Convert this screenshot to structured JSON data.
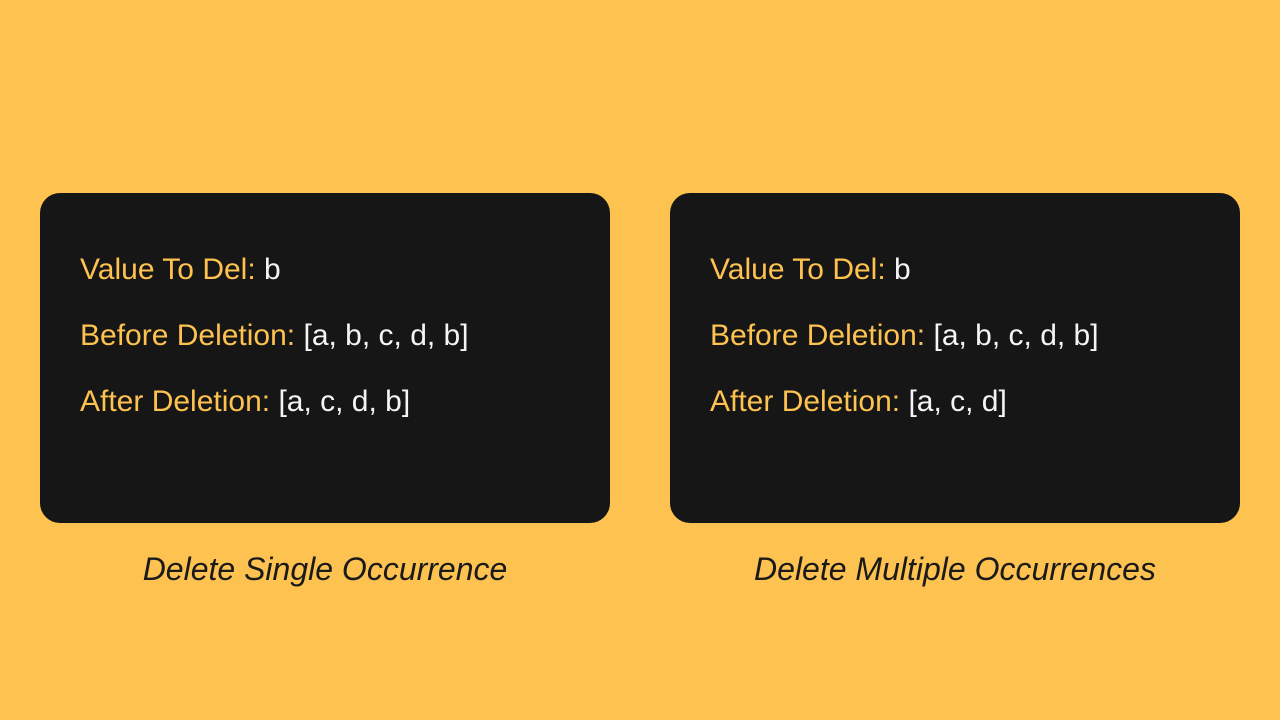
{
  "left": {
    "valueToDel": {
      "label": "Value To Del:",
      "value": "b"
    },
    "before": {
      "label": "Before Deletion:",
      "value": "[a, b, c, d, b]"
    },
    "after": {
      "label": "After Deletion:",
      "value": "[a, c, d, b]"
    },
    "caption": "Delete Single Occurrence"
  },
  "right": {
    "valueToDel": {
      "label": "Value To Del:",
      "value": "b"
    },
    "before": {
      "label": "Before Deletion:",
      "value": "[a, b, c, d, b]"
    },
    "after": {
      "label": "After Deletion:",
      "value": "[a, c, d]"
    },
    "caption": "Delete Multiple Occurrences"
  }
}
